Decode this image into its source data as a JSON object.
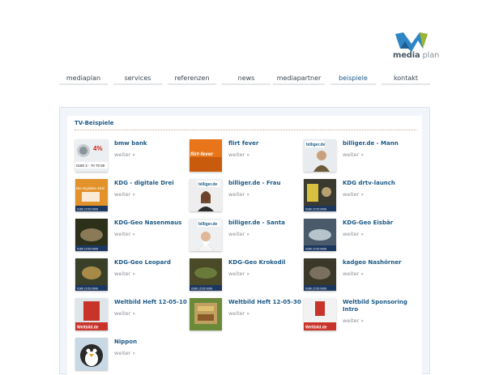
{
  "brand": {
    "name_bold": "media",
    "name_light": " plan"
  },
  "nav": {
    "items": [
      {
        "label": "mediaplan",
        "active": false
      },
      {
        "label": "services",
        "active": false
      },
      {
        "label": "referenzen",
        "active": false
      },
      {
        "label": "news",
        "active": false
      },
      {
        "label": "mediapartner",
        "active": false
      },
      {
        "label": "beispiele",
        "active": true
      },
      {
        "label": "kontakt",
        "active": false
      }
    ]
  },
  "section": {
    "title": "TV-Beispiele",
    "more_label": "weiter",
    "more_arrow": "»"
  },
  "items": [
    {
      "title": "bmw bank"
    },
    {
      "title": "flirt fever"
    },
    {
      "title": "billiger.de - Mann"
    },
    {
      "title": "KDG - digitale Drei"
    },
    {
      "title": "billiger.de - Frau"
    },
    {
      "title": "KDG drtv-launch"
    },
    {
      "title": "KDG-Geo Nasenmaus"
    },
    {
      "title": "billiger.de - Santa"
    },
    {
      "title": "KDG-Geo Eisbär"
    },
    {
      "title": "KDG-Geo Leopard"
    },
    {
      "title": "KDG-Geo Krokodil"
    },
    {
      "title": "kadgeo Nashörner"
    },
    {
      "title": "Weltbild Heft 12-05-10"
    },
    {
      "title": "Weltbild Heft 12-05-30"
    },
    {
      "title": "Weltbild Sponsoring Intro"
    },
    {
      "title": "Nippon"
    }
  ],
  "thumb_texts": {
    "bmw_big": "4%",
    "bmw_phone": "0180 3 - 70 70 80",
    "flirt": "flirt-fever",
    "billiger": "billiger.de",
    "kdg_digitale": "Die Digitalen Drei",
    "phone_strip": "0180 | 5 52 0000",
    "weltbild": "Weltbild.de"
  },
  "colors": {
    "accent": "#1c5a86",
    "more": "#8a8f94",
    "panel_bg": "#f1f5fa"
  }
}
